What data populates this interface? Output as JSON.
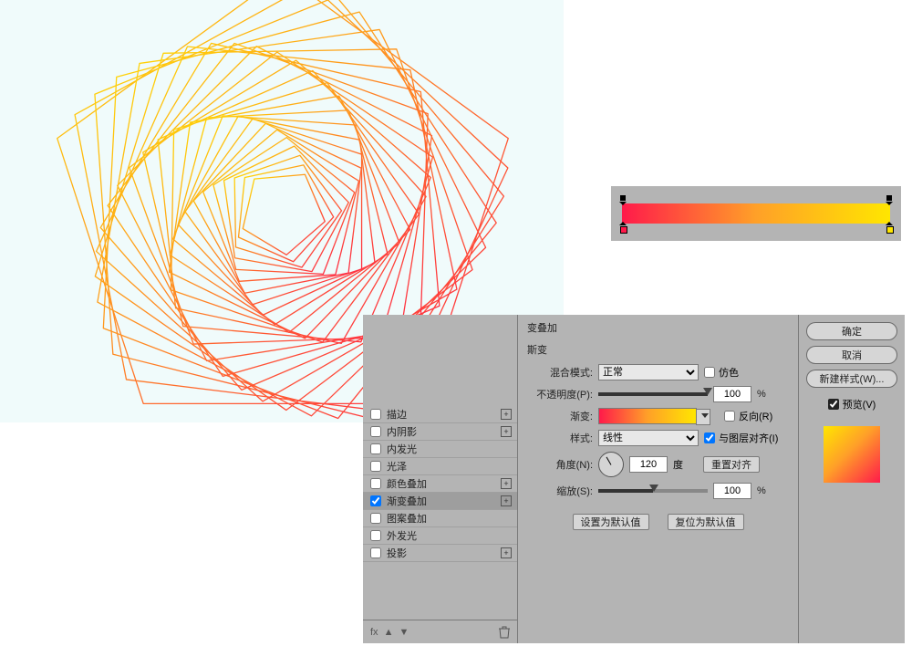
{
  "canvas": {
    "bg": "#f0fbfb",
    "gradient_from": "#ffe600",
    "gradient_to": "#ff1a4a"
  },
  "gradient_editor": {
    "from": "#ff1a4a",
    "to": "#ffe600"
  },
  "fx_list": {
    "items": [
      {
        "label": "描边",
        "plus": true
      },
      {
        "label": "内阴影",
        "plus": true
      },
      {
        "label": "内发光",
        "plus": false
      },
      {
        "label": "光泽",
        "plus": false
      },
      {
        "label": "颜色叠加",
        "plus": true
      },
      {
        "label": "渐变叠加",
        "plus": true,
        "checked": true,
        "selected": true
      },
      {
        "label": "图案叠加",
        "plus": false
      },
      {
        "label": "外发光",
        "plus": false
      },
      {
        "label": "投影",
        "plus": true
      }
    ],
    "footer_fx": "fx"
  },
  "settings": {
    "panel_title": "变叠加",
    "section_title": "斯变",
    "blend_label": "混合模式:",
    "blend_value": "正常",
    "dither_label": "仿色",
    "opacity_label": "不透明度(P):",
    "opacity_value": "100",
    "percent": "%",
    "gradient_label": "渐变:",
    "reverse_label": "反向(R)",
    "style_label": "样式:",
    "style_value": "线性",
    "align_label": "与图层对齐(I)",
    "angle_label": "角度(N):",
    "angle_value": "120",
    "degree": "度",
    "reset_align": "重置对齐",
    "scale_label": "缩放(S):",
    "scale_value": "100",
    "set_default": "设置为默认值",
    "reset_default": "复位为默认值"
  },
  "right": {
    "ok": "确定",
    "cancel": "取消",
    "new_style": "新建样式(W)...",
    "preview": "预览(V)"
  }
}
